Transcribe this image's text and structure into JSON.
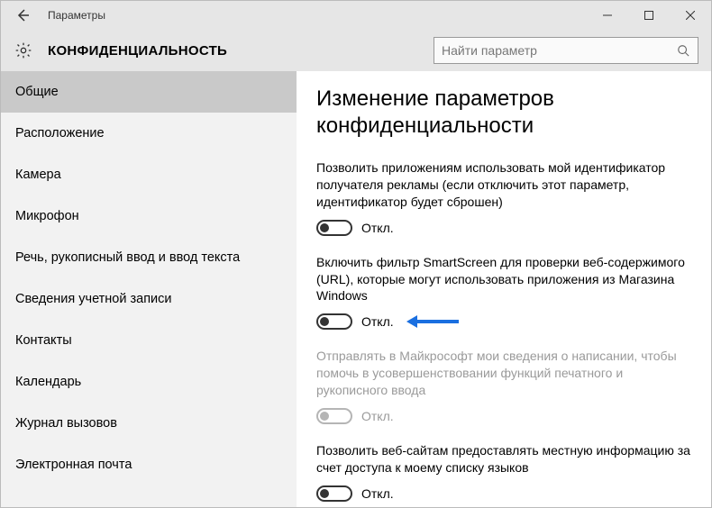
{
  "titlebar": {
    "title": "Параметры"
  },
  "header": {
    "category": "КОНФИДЕНЦИАЛЬНОСТЬ",
    "search_placeholder": "Найти параметр"
  },
  "sidebar": {
    "items": [
      {
        "label": "Общие",
        "selected": true
      },
      {
        "label": "Расположение"
      },
      {
        "label": "Камера"
      },
      {
        "label": "Микрофон"
      },
      {
        "label": "Речь, рукописный ввод и ввод текста"
      },
      {
        "label": "Сведения учетной записи"
      },
      {
        "label": "Контакты"
      },
      {
        "label": "Календарь"
      },
      {
        "label": "Журнал вызовов"
      },
      {
        "label": "Электронная почта"
      }
    ]
  },
  "content": {
    "heading": "Изменение параметров конфиденциальности",
    "settings": [
      {
        "text": "Позволить приложениям использовать мой идентификатор получателя рекламы (если отключить этот параметр, идентификатор будет сброшен)",
        "state": "Откл.",
        "on": false,
        "disabled": false,
        "hint": false
      },
      {
        "text": "Включить фильтр SmartScreen для проверки веб-содержимого (URL), которые могут использовать приложения из Магазина Windows",
        "state": "Откл.",
        "on": false,
        "disabled": false,
        "hint": true
      },
      {
        "text": "Отправлять в Майкрософт мои сведения о написании, чтобы помочь в усовершенствовании функций печатного и рукописного ввода",
        "state": "Откл.",
        "on": false,
        "disabled": true,
        "hint": false
      },
      {
        "text": "Позволить веб-сайтам предоставлять местную информацию за счет доступа к моему списку языков",
        "state": "Откл.",
        "on": false,
        "disabled": false,
        "hint": false
      }
    ]
  }
}
